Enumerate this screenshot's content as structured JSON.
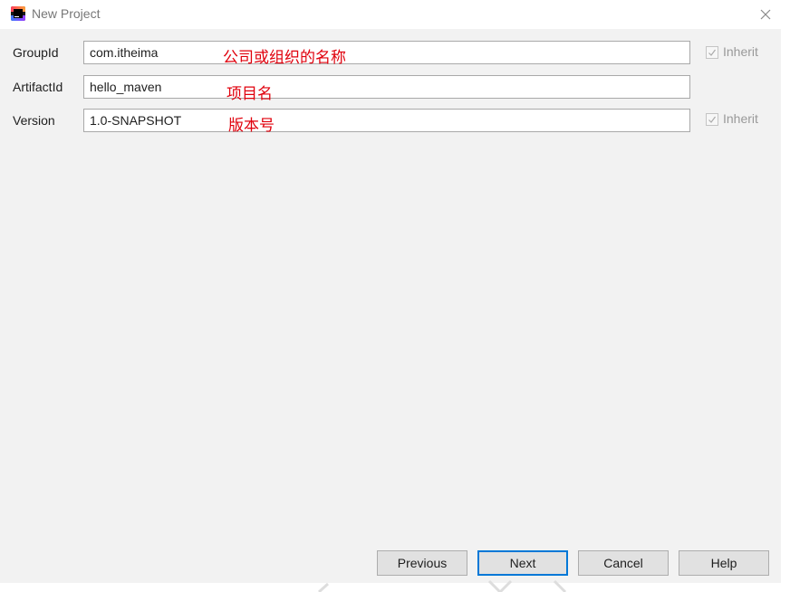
{
  "window": {
    "title": "New Project"
  },
  "form": {
    "group_id": {
      "label": "GroupId",
      "value": "com.itheima",
      "annotation": "公司或组织的名称",
      "inherit_label": "Inherit"
    },
    "artifact_id": {
      "label": "ArtifactId",
      "value": "hello_maven",
      "annotation": "项目名"
    },
    "version": {
      "label": "Version",
      "value": "1.0-SNAPSHOT",
      "annotation": "版本号",
      "inherit_label": "Inherit"
    }
  },
  "buttons": {
    "previous": "Previous",
    "next": "Next",
    "cancel": "Cancel",
    "help": "Help"
  },
  "colors": {
    "annotation": "#e0000c",
    "primary_border": "#0078d7",
    "dialog_bg": "#f2f2f2"
  },
  "icons": {
    "app": "intellij-idea-logo-icon",
    "close": "close-icon",
    "checkbox": "checkmark-icon"
  }
}
